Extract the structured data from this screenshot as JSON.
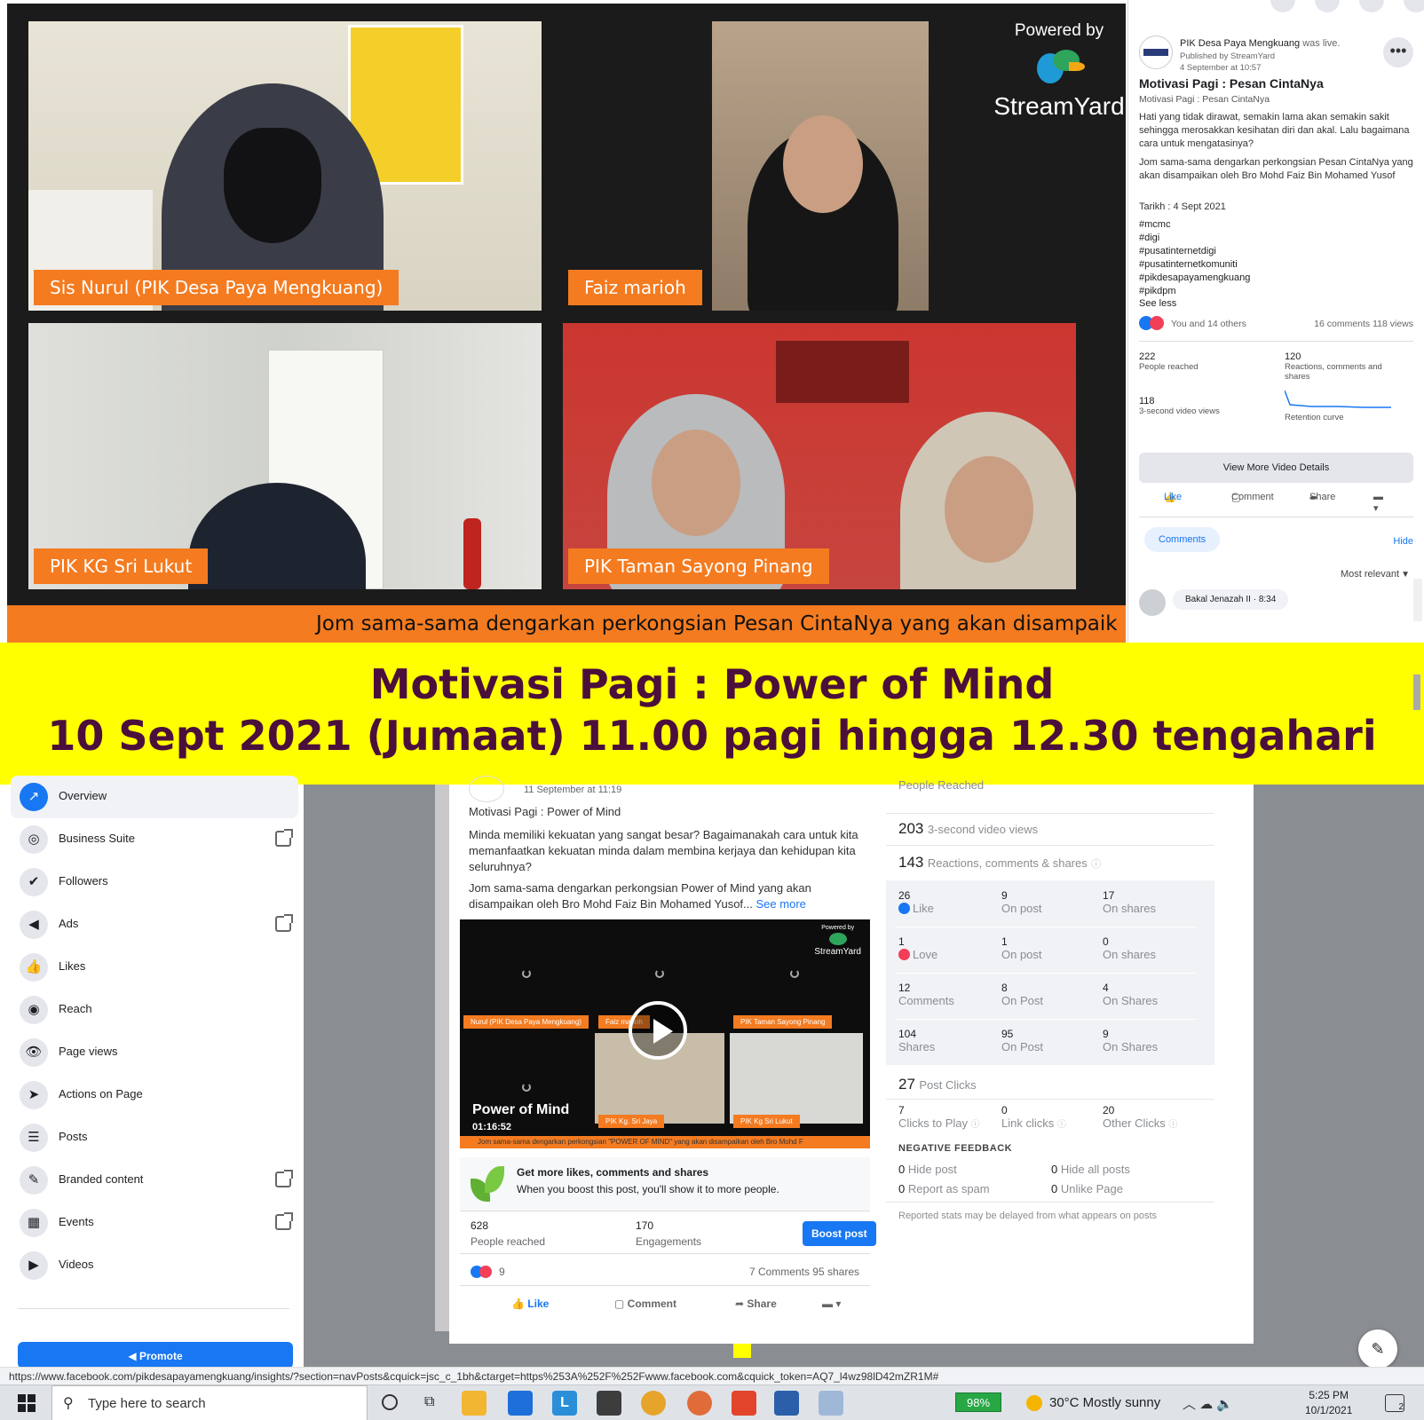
{
  "video_top": {
    "powered_by": "Powered by",
    "streamyard": "StreamYard",
    "participants": [
      {
        "name": "Sis Nurul (PIK Desa Paya Mengkuang)"
      },
      {
        "name": "Faiz marioh"
      },
      {
        "name": "PIK KG Sri Lukut"
      },
      {
        "name": "PIK Taman Sayong Pinang"
      }
    ],
    "ticker": "Jom sama-sama dengarkan perkongsian Pesan CintaNya yang akan disampaik"
  },
  "post": {
    "page_name": "PIK Desa Paya Mengkuang",
    "status": "was live.",
    "published_by": "Published by StreamYard",
    "date": "4 September at 10:57",
    "more_icon": "more-horizontal-icon",
    "title": "Motivasi Pagi : Pesan CintaNya",
    "subtitle": "Motivasi Pagi : Pesan CintaNya",
    "para1": "Hati yang tidak dirawat, semakin lama akan semakin sakit sehingga merosakkan kesihatan diri dan akal. Lalu bagaimana cara untuk mengatasinya?",
    "para2": "Jom sama-sama dengarkan perkongsian Pesan CintaNya yang akan disampaikan oleh Bro Mohd Faiz Bin Mohamed Yusof",
    "tarikh": "Tarikh : 4 Sept 2021",
    "hashtags": [
      "#mcmc",
      "#digi",
      "#pusatinternetdigi",
      "#pusatinternetkomuniti",
      "#pikdesapayamengkuang",
      "#pikdpm"
    ],
    "see_less": "See less",
    "reactions": "You and 14 others",
    "comments_views": "16 comments  118 views",
    "stats": [
      {
        "num": "222",
        "label": "People reached"
      },
      {
        "num": "120",
        "label": "Reactions, comments and shares"
      },
      {
        "num": "118",
        "label": "3-second video views"
      },
      {
        "num": "",
        "label": "Retention curve"
      }
    ],
    "view_more": "View More Video Details",
    "actions": {
      "like": "Like",
      "comment": "Comment",
      "share": "Share"
    },
    "comments_tab": "Comments",
    "hide": "Hide",
    "sort": "Most relevant",
    "comment_author": "Bakal Jenazah II",
    "comment_time": "8:34"
  },
  "banner": {
    "line1": "Motivasi Pagi : Power of Mind",
    "line2": "10 Sept 2021 (Jumaat) 11.00 pagi hingga 12.30 tengahari"
  },
  "sidebar": {
    "items": [
      {
        "label": "Overview",
        "icon": "overview-icon",
        "glyph": "↗",
        "active": true,
        "ext": false
      },
      {
        "label": "Business Suite",
        "icon": "business-suite-icon",
        "glyph": "◎",
        "active": false,
        "ext": true
      },
      {
        "label": "Followers",
        "icon": "followers-icon",
        "glyph": "✔",
        "active": false,
        "ext": false
      },
      {
        "label": "Ads",
        "icon": "megaphone-icon",
        "glyph": "◀",
        "active": false,
        "ext": true
      },
      {
        "label": "Likes",
        "icon": "thumbs-up-icon",
        "glyph": "👍",
        "active": false,
        "ext": false
      },
      {
        "label": "Reach",
        "icon": "reach-icon",
        "glyph": "◉",
        "active": false,
        "ext": false
      },
      {
        "label": "Page views",
        "icon": "eye-icon",
        "glyph": "👁",
        "active": false,
        "ext": false
      },
      {
        "label": "Actions on Page",
        "icon": "cursor-icon",
        "glyph": "➤",
        "active": false,
        "ext": false
      },
      {
        "label": "Posts",
        "icon": "posts-icon",
        "glyph": "☰",
        "active": false,
        "ext": false
      },
      {
        "label": "Branded content",
        "icon": "branded-content-icon",
        "glyph": "✎",
        "active": false,
        "ext": true
      },
      {
        "label": "Events",
        "icon": "calendar-icon",
        "glyph": "▦",
        "active": false,
        "ext": true
      },
      {
        "label": "Videos",
        "icon": "video-icon",
        "glyph": "▶",
        "active": false,
        "ext": false
      }
    ],
    "promote": "Promote"
  },
  "insights_post": {
    "date": "11 September at 11:19",
    "title": "Motivasi Pagi : Power of Mind",
    "para1": "Minda memiliki kekuatan yang sangat besar? Bagaimanakah cara untuk kita memanfaatkan kekuatan minda dalam membina kerjaya dan kehidupan kita seluruhnya?",
    "para2": "Jom sama-sama dengarkan perkongsian Power of Mind yang akan disampaikan oleh Bro Mohd Faiz Bin Mohamed Yusof...",
    "see_more": "See more",
    "video_title": "Power of Mind",
    "video_duration": "01:16:52",
    "video_tags": [
      "Nurul (PIK Desa Paya Mengkuang)",
      "Faiz marioh",
      "PIK Taman Sayong Pinang",
      "PIK Kg. Sri Jaya",
      "PIK Kg Sri Lukut"
    ],
    "powered_by": "Powered by",
    "streamyard": "StreamYard",
    "video_ticker": "Jom sama-sama dengarkan perkongsian \"POWER OF MIND\" yang akan disampaikan oleh Bro Mohd F",
    "boost_title": "Get more likes, comments and shares",
    "boost_desc": "When you boost this post, you'll show it to more people.",
    "reached_num": "628",
    "reached_label": "People reached",
    "eng_num": "170",
    "eng_label": "Engagements",
    "boost_btn": "Boost post",
    "reaction_count": "9",
    "comments_shares": "7 Comments  95 shares",
    "actions": {
      "like": "Like",
      "comment": "Comment",
      "share": "Share"
    }
  },
  "metrics": {
    "people_reached_label": "People Reached",
    "views_num": "203",
    "views_label": "3-second video views",
    "rcs_num": "143",
    "rcs_label": "Reactions, comments & shares",
    "rows": [
      [
        {
          "n": "26",
          "t": "Like"
        },
        {
          "n": "9",
          "t": "On post"
        },
        {
          "n": "17",
          "t": "On shares"
        }
      ],
      [
        {
          "n": "1",
          "t": "Love"
        },
        {
          "n": "1",
          "t": "On post"
        },
        {
          "n": "0",
          "t": "On shares"
        }
      ],
      [
        {
          "n": "12",
          "t": "Comments"
        },
        {
          "n": "8",
          "t": "On Post"
        },
        {
          "n": "4",
          "t": "On Shares"
        }
      ],
      [
        {
          "n": "104",
          "t": "Shares"
        },
        {
          "n": "95",
          "t": "On Post"
        },
        {
          "n": "9",
          "t": "On Shares"
        }
      ]
    ],
    "clicks_num": "27",
    "clicks_label": "Post Clicks",
    "click_cells": [
      {
        "n": "7",
        "t": "Clicks to Play"
      },
      {
        "n": "0",
        "t": "Link clicks"
      },
      {
        "n": "20",
        "t": "Other Clicks"
      }
    ],
    "nf_title": "NEGATIVE FEEDBACK",
    "nf": [
      {
        "n": "0",
        "t": "Hide post"
      },
      {
        "n": "0",
        "t": "Hide all posts"
      },
      {
        "n": "0",
        "t": "Report as spam"
      },
      {
        "n": "0",
        "t": "Unlike Page"
      }
    ],
    "delay_note": "Reported stats may be delayed from what appears on posts"
  },
  "status_url": "https://www.facebook.com/pikdesapayamengkuang/insights/?section=navPosts&cquick=jsc_c_1bh&ctarget=https%253A%252F%252Fwww.facebook.com&cquick_token=AQ7_l4wz98lD42mZR1M#",
  "taskbar": {
    "search_placeholder": "Type here to search",
    "battery": "98%",
    "weather": "30°C  Mostly sunny",
    "time": "5:25 PM",
    "date": "10/1/2021",
    "notif_count": "2"
  },
  "colors": {
    "fb_blue": "#1877f2",
    "streamyard_orange": "#f47b20",
    "banner_yellow": "#ffff00",
    "banner_text": "#4b0f3c"
  }
}
